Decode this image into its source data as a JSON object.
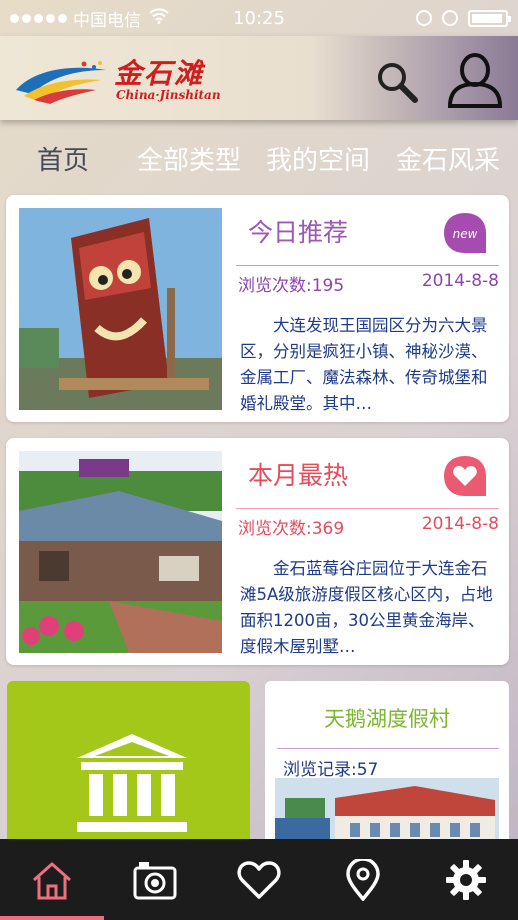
{
  "status": {
    "carrier": "中国电信",
    "time": "10:25",
    "battery_level": 0.95
  },
  "header": {
    "brand_cn": "金石滩",
    "brand_en": "China·Jinshitan",
    "search_icon": "search-icon",
    "user_icon": "user-icon"
  },
  "nav": {
    "tabs": [
      {
        "label": "首页"
      },
      {
        "label": "全部类型"
      },
      {
        "label": "我的空间"
      },
      {
        "label": "金石风采"
      }
    ]
  },
  "cards": [
    {
      "title": "今日推荐",
      "badge": "new",
      "views": "浏览次数:195",
      "date": "2014-8-8",
      "desc": "大连发现王国园区分为六大景区，分别是疯狂小镇、神秘沙漠、金属工厂、魔法森林、传奇城堡和婚礼殿堂。其中…"
    },
    {
      "title": "本月最热",
      "badge_icon": "heart-icon",
      "views": "浏览次数:369",
      "date": "2014-8-8",
      "desc": "金石蓝莓谷庄园位于大连金石滩5A级旅游度假区核心区内，占地面积1200亩，30公里黄金海岸、度假木屋别墅…"
    }
  ],
  "tiles": {
    "green_icon": "bank-icon",
    "white": {
      "title": "天鹅湖度假村",
      "views": "浏览记录:57"
    }
  },
  "tabbar": {
    "items": [
      {
        "icon": "home-icon",
        "active": true
      },
      {
        "icon": "camera-icon",
        "active": false
      },
      {
        "icon": "heart-icon",
        "active": false
      },
      {
        "icon": "location-pin-icon",
        "active": false
      },
      {
        "icon": "gear-icon",
        "active": false
      }
    ]
  },
  "colors": {
    "accent_purple": "#9b59b6",
    "accent_red": "#e74c5c",
    "tile_green": "#a3c81a",
    "tabbar_bg": "#1c1c1c",
    "tab_active": "#ee6f7e"
  }
}
